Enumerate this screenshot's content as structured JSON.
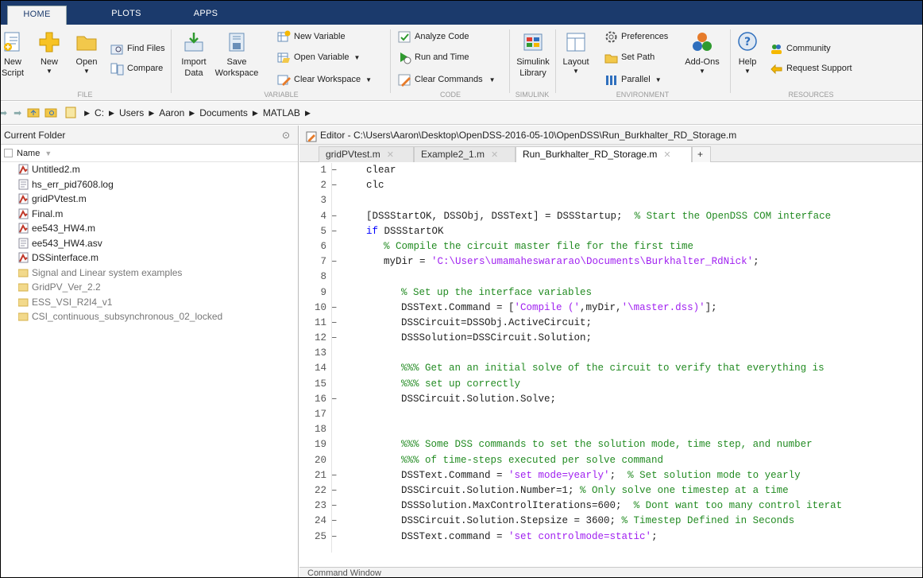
{
  "ribbon_tabs": [
    "HOME",
    "PLOTS",
    "APPS"
  ],
  "file_group": {
    "label": "FILE",
    "new_script": [
      "New",
      "Script"
    ],
    "new": "New",
    "open": "Open",
    "find_files": "Find Files",
    "compare": "Compare"
  },
  "variable_group": {
    "label": "VARIABLE",
    "import_data": [
      "Import",
      "Data"
    ],
    "save_workspace": [
      "Save",
      "Workspace"
    ],
    "new_variable": "New Variable",
    "open_variable": "Open Variable",
    "clear_workspace": "Clear Workspace"
  },
  "code_group": {
    "label": "CODE",
    "analyze_code": "Analyze Code",
    "run_and_time": "Run and Time",
    "clear_commands": "Clear Commands"
  },
  "simulink_group": {
    "label": "SIMULINK",
    "simulink_library": [
      "Simulink",
      "Library"
    ]
  },
  "environment_group": {
    "label": "ENVIRONMENT",
    "layout": "Layout",
    "preferences": "Preferences",
    "set_path": "Set Path",
    "parallel": "Parallel",
    "add_ons": "Add-Ons"
  },
  "resources_group": {
    "label": "RESOURCES",
    "help": "Help",
    "community": "Community",
    "request_support": "Request Support"
  },
  "address_path": [
    "C:",
    "Users",
    "Aaron",
    "Documents",
    "MATLAB"
  ],
  "current_folder": {
    "title": "Current Folder",
    "column_name": "Name",
    "files": [
      {
        "name": "Untitled2.m",
        "type": "m"
      },
      {
        "name": "hs_err_pid7608.log",
        "type": "log"
      },
      {
        "name": "gridPVtest.m",
        "type": "m"
      },
      {
        "name": "Final.m",
        "type": "m"
      },
      {
        "name": "ee543_HW4.m",
        "type": "m"
      },
      {
        "name": "ee543_HW4.asv",
        "type": "asv"
      },
      {
        "name": "DSSinterface.m",
        "type": "m"
      },
      {
        "name": "Signal and Linear system examples",
        "type": "folder"
      },
      {
        "name": "GridPV_Ver_2.2",
        "type": "folder"
      },
      {
        "name": "ESS_VSI_R2I4_v1",
        "type": "folder"
      },
      {
        "name": "CSI_continuous_subsynchronous_02_locked",
        "type": "folder"
      }
    ]
  },
  "editor": {
    "title": "Editor - C:\\Users\\Aaron\\Desktop\\OpenDSS-2016-05-10\\OpenDSS\\Run_Burkhalter_RD_Storage.m",
    "tabs": [
      "gridPVtest.m",
      "Example2_1.m",
      "Run_Burkhalter_RD_Storage.m"
    ],
    "active_tab": "Run_Burkhalter_RD_Storage.m",
    "add_tab": "+"
  },
  "code_lines": [
    {
      "n": "1",
      "dash": true,
      "indent": 1,
      "parts": [
        [
          "t",
          "clear"
        ]
      ]
    },
    {
      "n": "2",
      "dash": true,
      "indent": 1,
      "parts": [
        [
          "t",
          "clc"
        ]
      ]
    },
    {
      "n": "3",
      "dash": false,
      "indent": 0,
      "parts": []
    },
    {
      "n": "4",
      "dash": true,
      "indent": 1,
      "parts": [
        [
          "t",
          "[DSSStartOK, DSSObj, DSSText] = DSSStartup;  "
        ],
        [
          "c",
          "% Start the OpenDSS COM interface"
        ]
      ]
    },
    {
      "n": "5",
      "dash": true,
      "indent": 1,
      "parts": [
        [
          "k",
          "if"
        ],
        [
          "t",
          " DSSStartOK"
        ]
      ]
    },
    {
      "n": "6",
      "dash": false,
      "indent": 3,
      "parts": [
        [
          "c",
          "% Compile the circuit master file for the first time"
        ]
      ]
    },
    {
      "n": "7",
      "dash": true,
      "indent": 3,
      "parts": [
        [
          "t",
          "myDir = "
        ],
        [
          "s",
          "'C:\\Users\\umamaheswararao\\Documents\\Burkhalter_RdNick'"
        ],
        [
          "t",
          ";"
        ]
      ]
    },
    {
      "n": "8",
      "dash": false,
      "indent": 0,
      "parts": []
    },
    {
      "n": "9",
      "dash": false,
      "indent": 4,
      "parts": [
        [
          "c",
          "% Set up the interface variables"
        ]
      ]
    },
    {
      "n": "10",
      "dash": true,
      "indent": 4,
      "parts": [
        [
          "t",
          "DSSText.Command = ["
        ],
        [
          "s",
          "'Compile ('"
        ],
        [
          "t",
          ",myDir,"
        ],
        [
          "s",
          "'\\master.dss)'"
        ],
        [
          "t",
          "];"
        ]
      ]
    },
    {
      "n": "11",
      "dash": true,
      "indent": 4,
      "parts": [
        [
          "t",
          "DSSCircuit=DSSObj.ActiveCircuit;"
        ]
      ]
    },
    {
      "n": "12",
      "dash": true,
      "indent": 4,
      "parts": [
        [
          "t",
          "DSSSolution=DSSCircuit.Solution;"
        ]
      ]
    },
    {
      "n": "13",
      "dash": false,
      "indent": 0,
      "parts": []
    },
    {
      "n": "14",
      "dash": false,
      "indent": 4,
      "parts": [
        [
          "c",
          "%%% Get an an initial solve of the circuit to verify that everything is"
        ]
      ]
    },
    {
      "n": "15",
      "dash": false,
      "indent": 4,
      "parts": [
        [
          "c",
          "%%% set up correctly"
        ]
      ]
    },
    {
      "n": "16",
      "dash": true,
      "indent": 4,
      "parts": [
        [
          "t",
          "DSSCircuit.Solution.Solve;"
        ]
      ]
    },
    {
      "n": "17",
      "dash": false,
      "indent": 0,
      "parts": []
    },
    {
      "n": "18",
      "dash": false,
      "indent": 0,
      "parts": []
    },
    {
      "n": "19",
      "dash": false,
      "indent": 4,
      "parts": [
        [
          "c",
          "%%% Some DSS commands to set the solution mode, time step, and number"
        ]
      ]
    },
    {
      "n": "20",
      "dash": false,
      "indent": 4,
      "parts": [
        [
          "c",
          "%%% of time-steps executed per solve command"
        ]
      ]
    },
    {
      "n": "21",
      "dash": true,
      "indent": 4,
      "parts": [
        [
          "t",
          "DSSText.Command = "
        ],
        [
          "s",
          "'set mode=yearly'"
        ],
        [
          "t",
          ";  "
        ],
        [
          "c",
          "% Set solution mode to yearly"
        ]
      ]
    },
    {
      "n": "22",
      "dash": true,
      "indent": 4,
      "parts": [
        [
          "t",
          "DSSCircuit.Solution.Number=1; "
        ],
        [
          "c",
          "% Only solve one timestep at a time"
        ]
      ]
    },
    {
      "n": "23",
      "dash": true,
      "indent": 4,
      "parts": [
        [
          "t",
          "DSSSolution.MaxControlIterations=600;  "
        ],
        [
          "c",
          "% Dont want too many control iterat"
        ]
      ]
    },
    {
      "n": "24",
      "dash": true,
      "indent": 4,
      "parts": [
        [
          "t",
          "DSSCircuit.Solution.Stepsize = 3600; "
        ],
        [
          "c",
          "% Timestep Defined in Seconds"
        ]
      ]
    },
    {
      "n": "25",
      "dash": true,
      "indent": 4,
      "parts": [
        [
          "t",
          "DSSText.command = "
        ],
        [
          "s",
          "'set controlmode=static'"
        ],
        [
          "t",
          ";"
        ]
      ]
    }
  ],
  "command_window": {
    "title": "Command Window"
  }
}
